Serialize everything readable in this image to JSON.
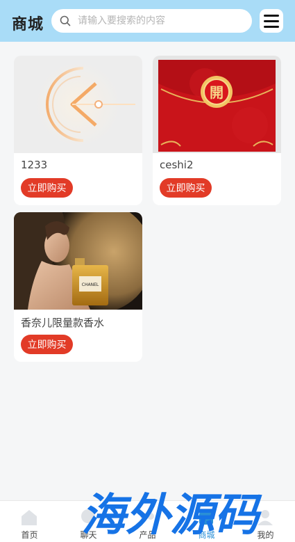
{
  "header": {
    "title": "商城",
    "search_placeholder": "请输入要搜索的内容",
    "search_value": "",
    "menu_icon": "hamburger-menu-icon"
  },
  "products": [
    {
      "name": "1233",
      "buy_label": "立即购买",
      "image": "glowing-arrow-logo"
    },
    {
      "name": "ceshi2",
      "buy_label": "立即购买",
      "image": "red-envelope"
    },
    {
      "name": "香奈儿限量款香水",
      "buy_label": "立即购买",
      "image": "perfume-advert"
    }
  ],
  "tabbar": {
    "items": [
      {
        "label": "首页",
        "icon": "home-icon"
      },
      {
        "label": "聊天",
        "icon": "chat-icon"
      },
      {
        "label": "产品",
        "icon": "product-icon"
      },
      {
        "label": "商城",
        "icon": "shop-icon",
        "active": true
      },
      {
        "label": "我的",
        "icon": "user-icon"
      }
    ]
  },
  "watermark": "海外源码",
  "colors": {
    "header_bg": "#a9dcf7",
    "buy_button": "#e23b27",
    "active_tab": "#2a8fd6",
    "page_bg": "#f5f6f7"
  }
}
